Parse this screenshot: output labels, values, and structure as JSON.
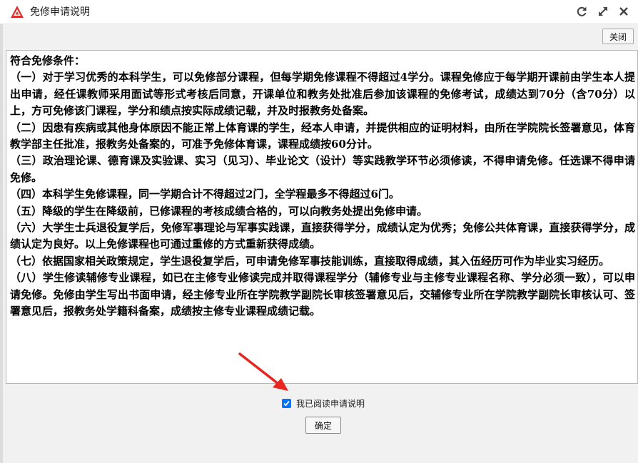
{
  "window": {
    "title": "免修申请说明",
    "icon": "triangle-logo-icon",
    "controls": [
      "refresh-icon",
      "maximize-icon",
      "close-icon"
    ]
  },
  "toolbar": {
    "close_label": "关闭"
  },
  "content": {
    "paragraphs": [
      "符合免修条件：",
      "（一）对于学习优秀的本科学生，可以免修部分课程，但每学期免修课程不得超过4学分。课程免修应于每学期开课前由学生本人提出申请，经任课教师采用面试等形式考核后同意，开课单位和教务处批准后参加该课程的免修考试，成绩达到70分（含70分）以上，方可免修该门课程，学分和绩点按实际成绩记载，并及时报教务处备案。",
      "（二）因患有疾病或其他身体原因不能正常上体育课的学生，经本人申请，并提供相应的证明材料，由所在学院院长签署意见，体育教学部主任批准，报教务处备案的，可准予免修体育课，课程成绩按60分计。",
      "（三）政治理论课、德育课及实验课、实习（见习）、毕业论文（设计）等实践教学环节必须修读，不得申请免修。任选课不得申请免修。",
      "（四）本科学生免修课程，同一学期合计不得超过2门，全学程最多不得超过6门。",
      "（五）降级的学生在降级前，已修课程的考核成绩合格的，可以向教务处提出免修申请。",
      "（六）大学生士兵退役复学后，免修军事理论与军事实践课，直接获得学分，成绩认定为优秀；免修公共体育课，直接获得学分，成绩认定为良好。以上免修课程也可通过重修的方式重新获得成绩。",
      "（七）依据国家相关政策规定，学生退役复学后，可申请免修军事技能训练，直接取得成绩，其入伍经历可作为毕业实习经历。",
      "（八）学生修读辅修专业课程，如已在主修专业修读完成并取得课程学分（辅修专业与主修专业课程名称、学分必须一致），可以申请免修。免修由学生写出书面申请，经主修专业所在学院教学副院长审核签署意见后，交辅修专业所在学院教学副院长审核认可、签署意见后，报教务处学籍科备案，成绩按主修专业课程成绩记载。"
    ]
  },
  "agreement": {
    "label": "我已阅读申请说明",
    "checked": true
  },
  "actions": {
    "confirm_label": "确定"
  },
  "colors": {
    "accent": "#0075ff",
    "annotation_arrow": "#e8251f",
    "logo": "#d9302b"
  }
}
